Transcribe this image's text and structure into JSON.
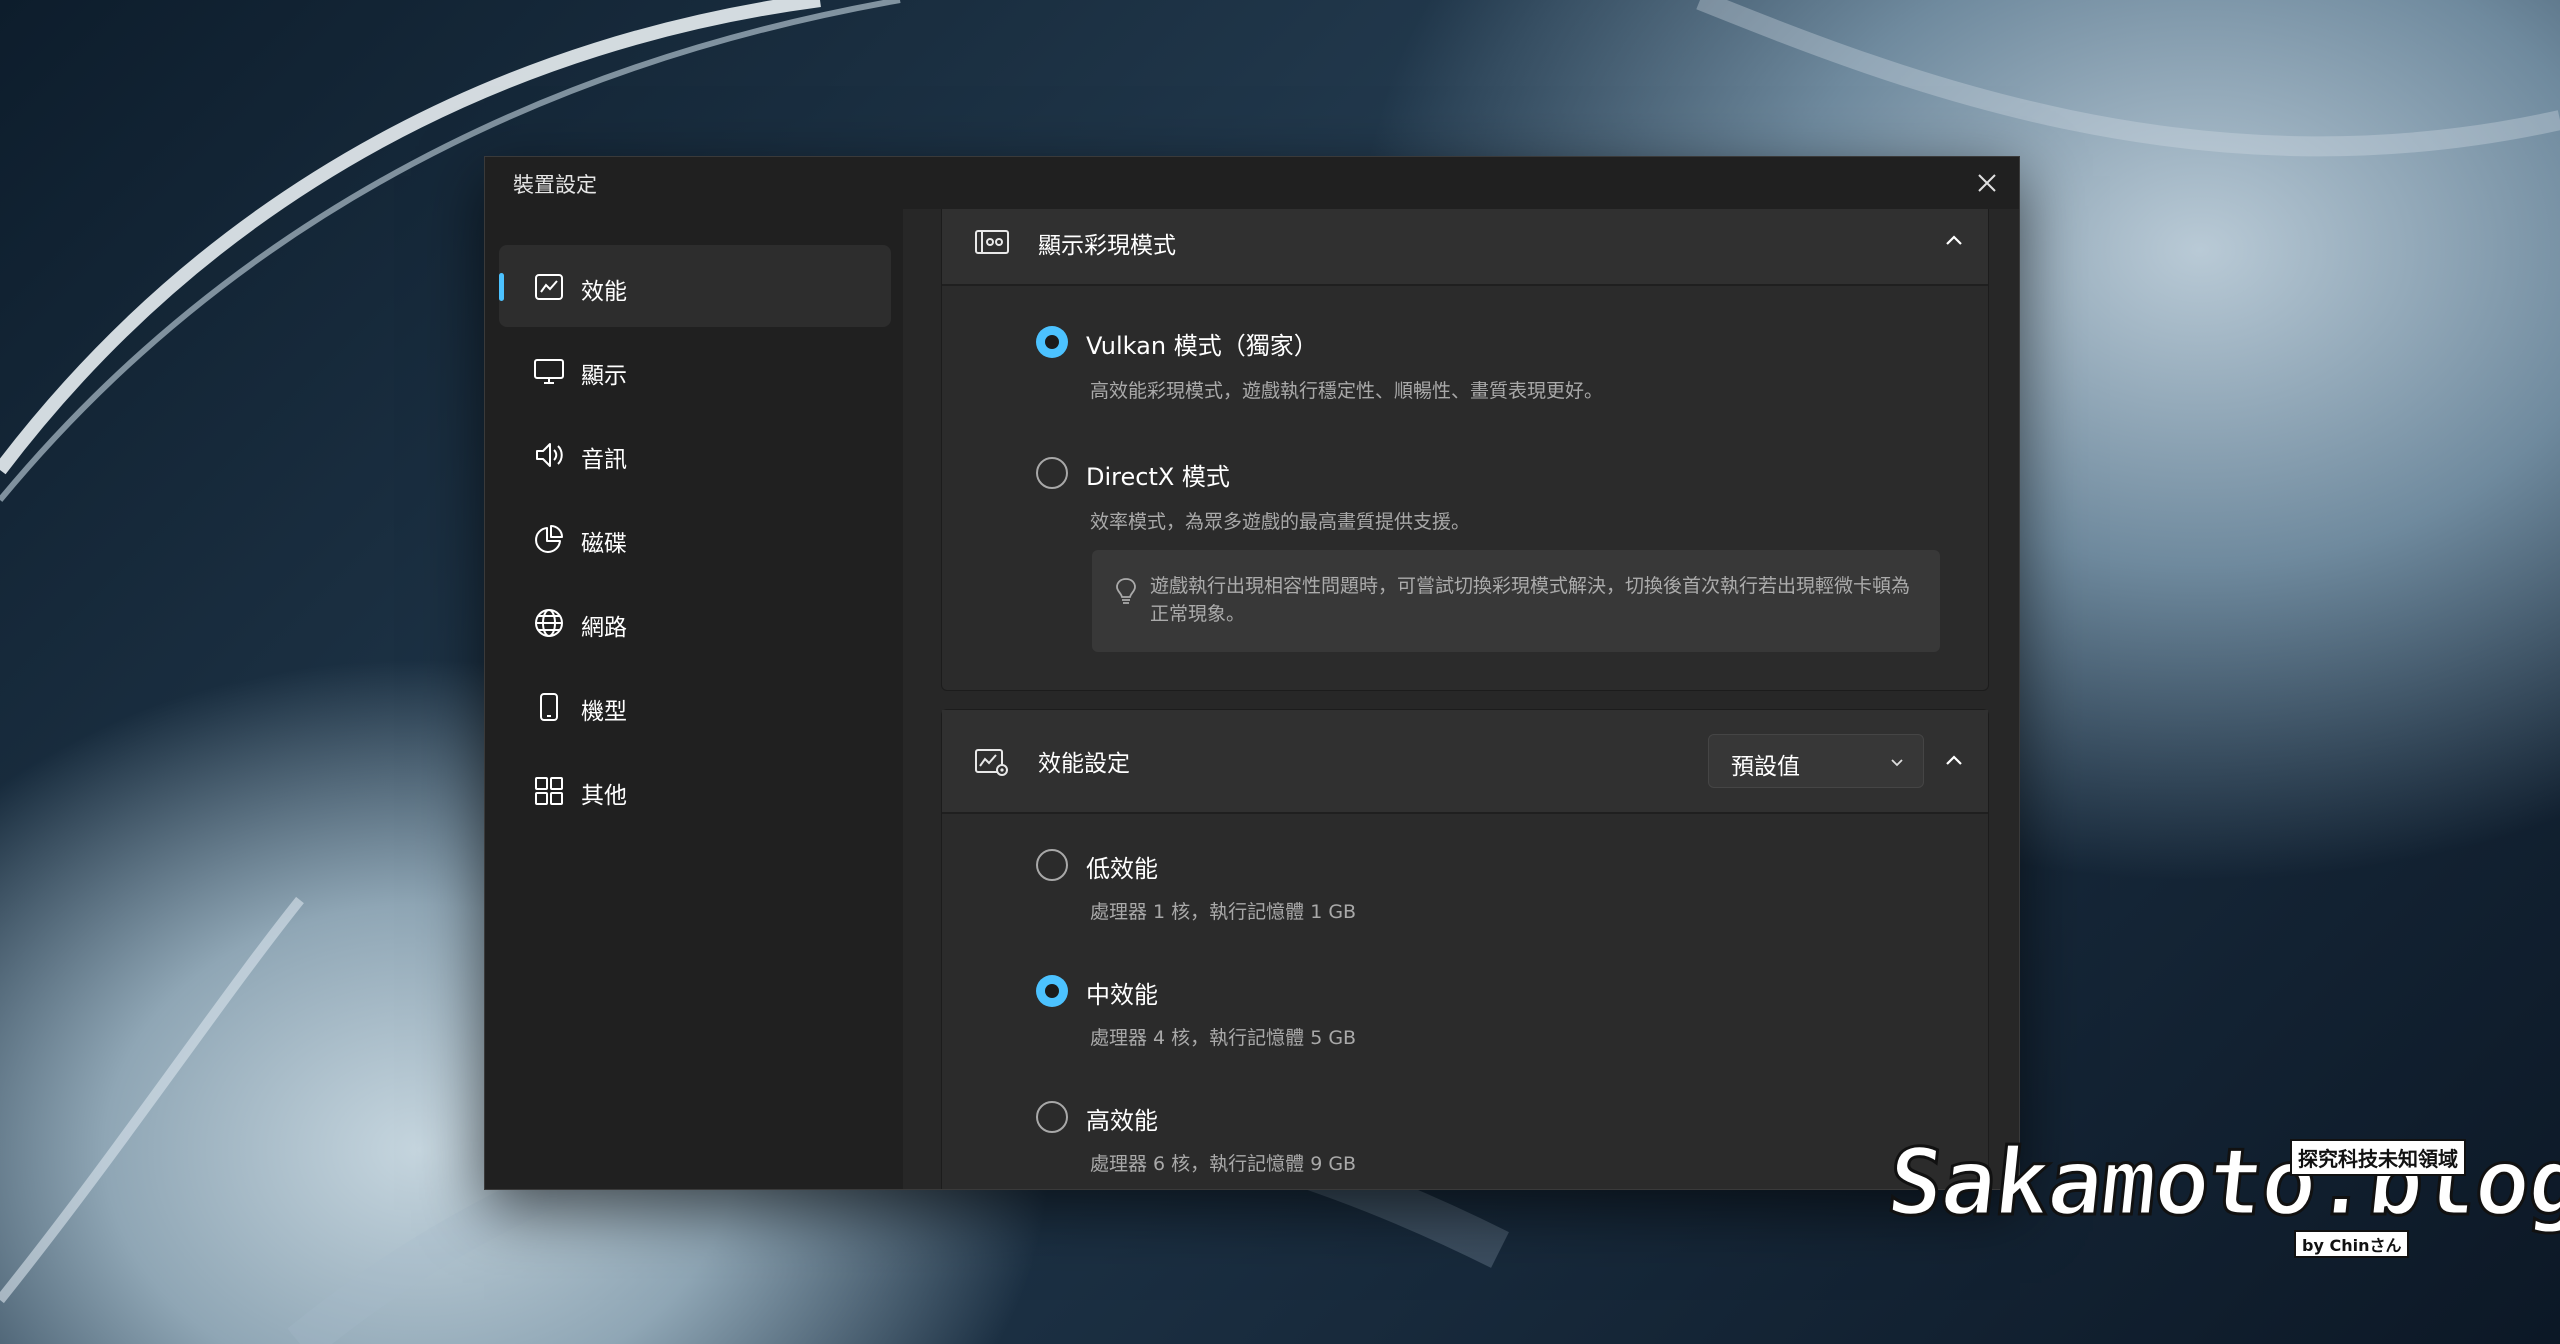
{
  "window": {
    "title": "裝置設定"
  },
  "sidebar": {
    "items": [
      {
        "label": "效能",
        "icon": "performance-chart-icon",
        "active": true
      },
      {
        "label": "顯示",
        "icon": "monitor-icon",
        "active": false
      },
      {
        "label": "音訊",
        "icon": "speaker-icon",
        "active": false
      },
      {
        "label": "磁碟",
        "icon": "pie-chart-icon",
        "active": false
      },
      {
        "label": "網路",
        "icon": "globe-icon",
        "active": false
      },
      {
        "label": "機型",
        "icon": "phone-icon",
        "active": false
      },
      {
        "label": "其他",
        "icon": "grid-icon",
        "active": false
      }
    ]
  },
  "render_mode_card": {
    "title": "顯示彩現模式",
    "options": [
      {
        "label": "Vulkan 模式（獨家）",
        "description": "高效能彩現模式，遊戲執行穩定性、順暢性、畫質表現更好。",
        "selected": true
      },
      {
        "label": "DirectX 模式",
        "description": "效率模式，為眾多遊戲的最高畫質提供支援。",
        "selected": false
      }
    ],
    "tip": "遊戲執行出現相容性問題時，可嘗試切換彩現模式解決，切換後首次執行若出現輕微卡頓為正常現象。"
  },
  "performance_card": {
    "title": "效能設定",
    "dropdown_value": "預設值",
    "options": [
      {
        "label": "低效能",
        "description": "處理器 1 核，執行記憶體 1 GB",
        "selected": false
      },
      {
        "label": "中效能",
        "description": "處理器 4 核，執行記憶體 5 GB",
        "selected": true
      },
      {
        "label": "高效能",
        "description": "處理器 6 核，執行記憶體 9 GB",
        "selected": false
      }
    ]
  },
  "watermark": {
    "text": "Sakamoto.blog",
    "tag": "探究科技未知領域",
    "byline": "by Chinさん"
  },
  "colors": {
    "accent": "#4cc2ff",
    "window_bg": "#202020",
    "content_bg": "#272727",
    "card_bg": "#2b2b2b"
  }
}
